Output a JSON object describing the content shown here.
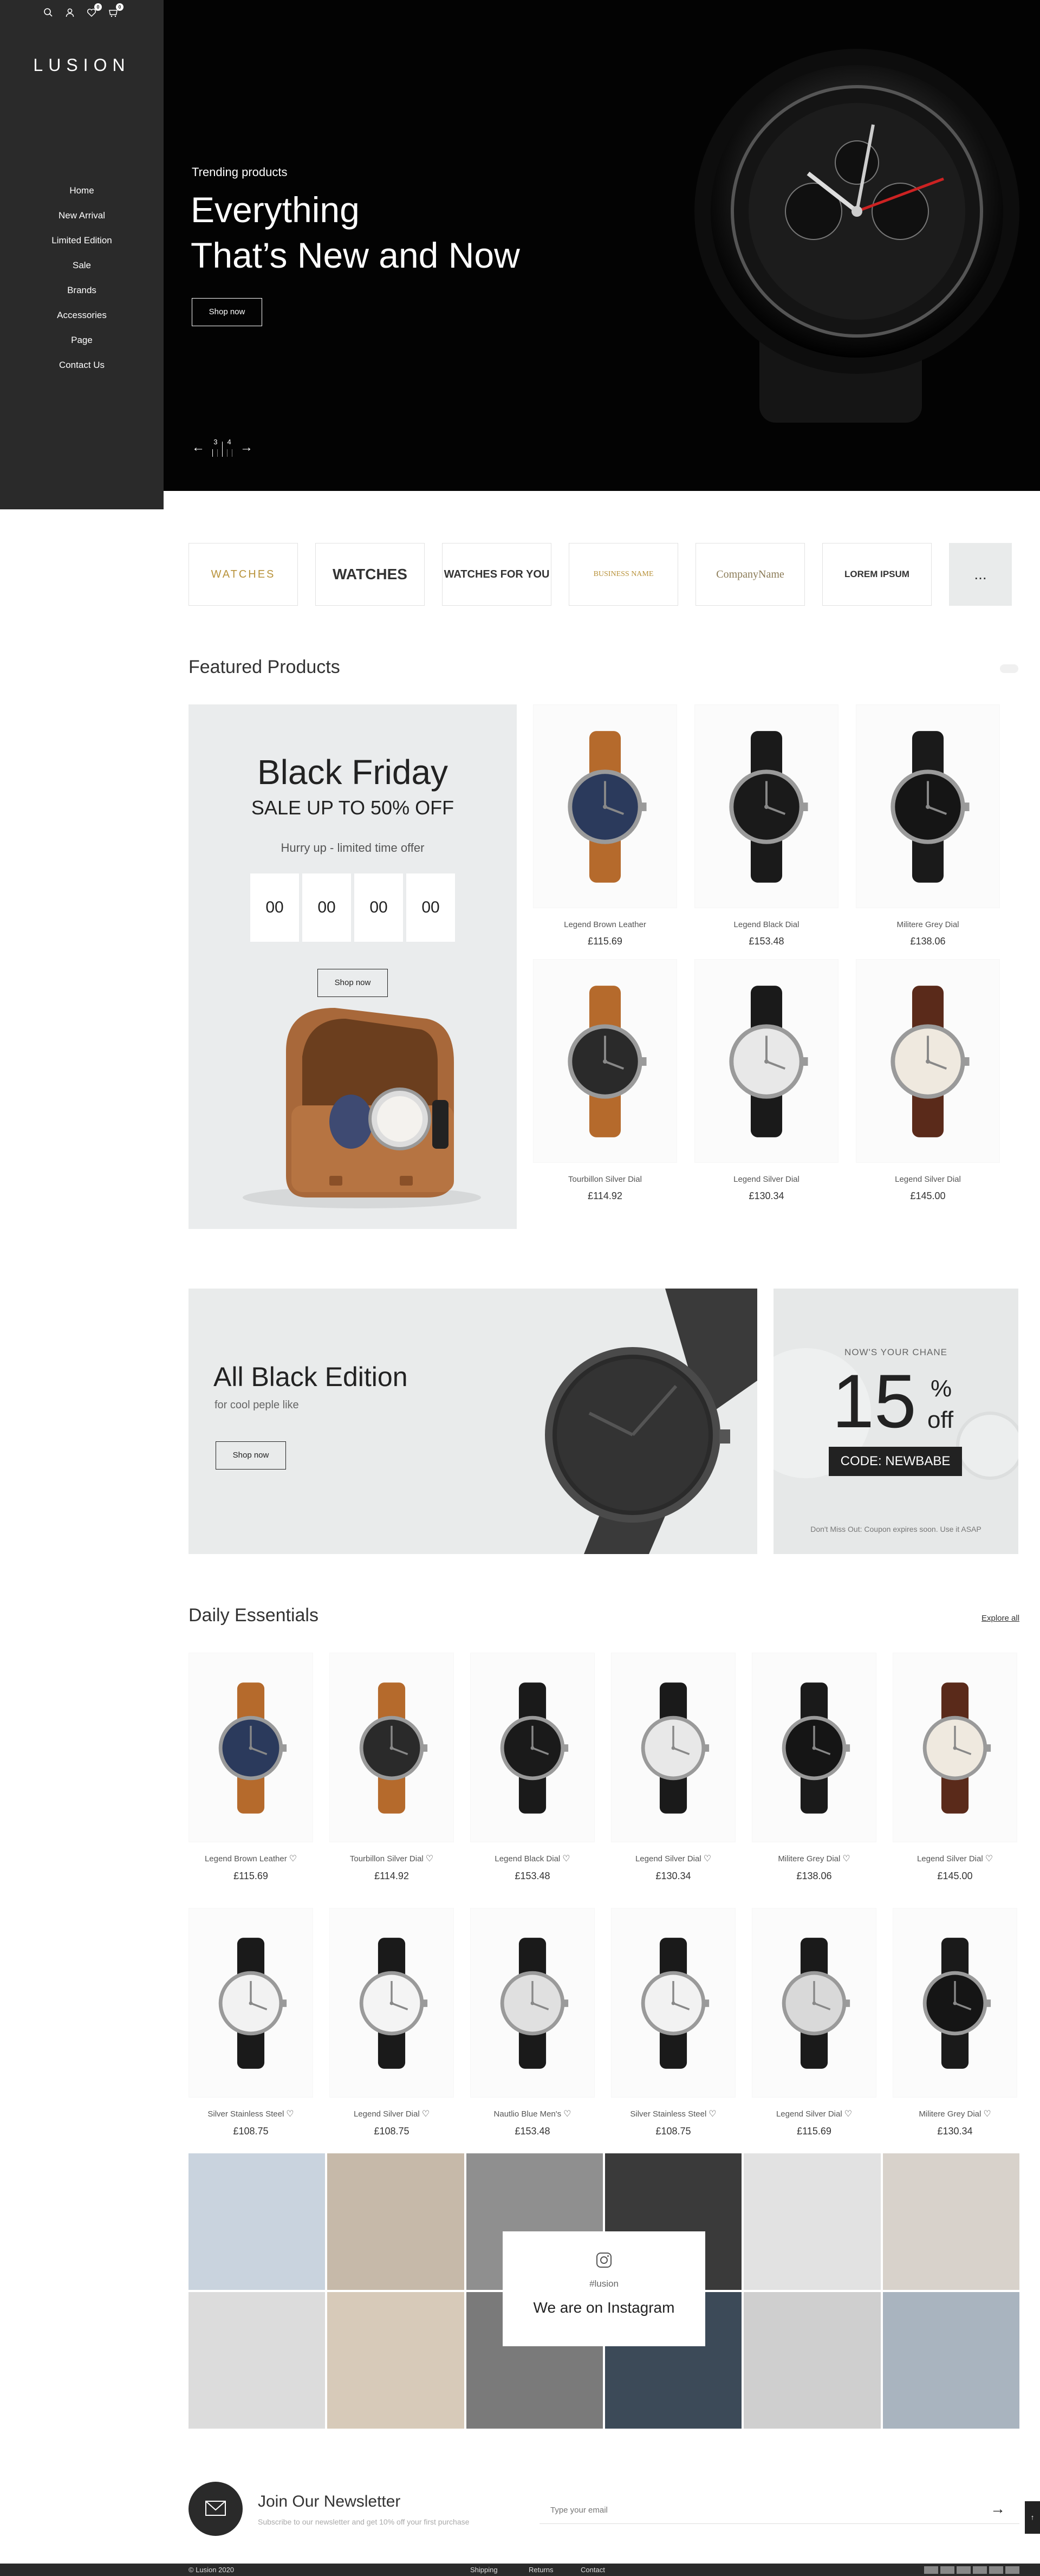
{
  "brand": "LUSION",
  "sidebar": {
    "items": [
      "Home",
      "New Arrival",
      "Limited Edition",
      "Sale",
      "Brands",
      "Accessories",
      "Page",
      "Contact Us"
    ],
    "wishlist_count": "0",
    "cart_count": "0"
  },
  "hero": {
    "subtitle": "Trending products",
    "title_line1": "Everything",
    "title_line2": "That’s New and Now",
    "button": "Shop now",
    "slide_current": "3",
    "slide_next": "4"
  },
  "brands": [
    "WATCHES",
    "WATCHES",
    "WATCHES FOR YOU",
    "BUSINESS NAME",
    "CompanyName",
    "LOREM IPSUM",
    "..."
  ],
  "featured": {
    "title": "Featured Products",
    "promo": {
      "title": "Black Friday",
      "subtitle": "SALE UP TO 50% OFF",
      "hurry": "Hurry up - limited time offer",
      "countdown": [
        "00",
        "00",
        "00",
        "00"
      ],
      "button": "Shop now"
    },
    "products": [
      {
        "name": "Legend Brown Leather",
        "price": "£115.69",
        "face": "#2b3a5c",
        "strap": "#b56a2c"
      },
      {
        "name": "Legend Black Dial",
        "price": "£153.48",
        "face": "#1a1a1a",
        "strap": "#1a1a1a"
      },
      {
        "name": "Militere Grey Dial",
        "price": "£138.06",
        "face": "#151515",
        "strap": "#1a1a1a"
      },
      {
        "name": "Tourbillon Silver Dial",
        "price": "£114.92",
        "face": "#2a2a2a",
        "strap": "#b56a2c"
      },
      {
        "name": "Legend Silver Dial",
        "price": "£130.34",
        "face": "#e8e8e8",
        "strap": "#1a1a1a"
      },
      {
        "name": "Legend Silver Dial",
        "price": "£145.00",
        "face": "#efe9df",
        "strap": "#5a2a1a"
      }
    ]
  },
  "all_black": {
    "title": "All Black Edition",
    "subtitle": "for cool peple like",
    "button": "Shop now"
  },
  "coupon": {
    "kicker": "NOW'S YOUR CHANE",
    "number": "15",
    "percent": "%",
    "off": "off",
    "code": "CODE: NEWBABE",
    "note": "Don't Miss Out: Coupon expires soon. Use it ASAP"
  },
  "daily": {
    "title": "Daily Essentials",
    "explore": "Explore all",
    "products": [
      {
        "name": "Legend Brown Leather",
        "price": "£115.69",
        "face": "#2b3a5c",
        "strap": "#b56a2c"
      },
      {
        "name": "Tourbillon Silver Dial",
        "price": "£114.92",
        "face": "#2a2a2a",
        "strap": "#b56a2c"
      },
      {
        "name": "Legend Black Dial",
        "price": "£153.48",
        "face": "#1a1a1a",
        "strap": "#1a1a1a"
      },
      {
        "name": "Legend Silver Dial",
        "price": "£130.34",
        "face": "#e8e8e8",
        "strap": "#1a1a1a"
      },
      {
        "name": "Militere Grey Dial",
        "price": "£138.06",
        "face": "#151515",
        "strap": "#1a1a1a"
      },
      {
        "name": "Legend Silver Dial",
        "price": "£145.00",
        "face": "#efe9df",
        "strap": "#5a2a1a"
      },
      {
        "name": "Silver Stainless Steel",
        "price": "£108.75",
        "face": "#f2f2f2",
        "strap": "#1a1a1a"
      },
      {
        "name": "Legend Silver Dial",
        "price": "£108.75",
        "face": "#f4f4f4",
        "strap": "#1a1a1a"
      },
      {
        "name": "Nautlio Blue Men's",
        "price": "£153.48",
        "face": "#e0e0e0",
        "strap": "#1a1a1a"
      },
      {
        "name": "Silver Stainless Steel",
        "price": "£108.75",
        "face": "#f2f2f2",
        "strap": "#1a1a1a"
      },
      {
        "name": "Legend Silver Dial",
        "price": "£115.69",
        "face": "#d9d9d9",
        "strap": "#1a1a1a"
      },
      {
        "name": "Militere Grey Dial",
        "price": "£130.34",
        "face": "#151515",
        "strap": "#1a1a1a"
      }
    ]
  },
  "instagram": {
    "handle": "#lusion",
    "title": "We are on Instagram"
  },
  "newsletter": {
    "title": "Join Our Newsletter",
    "subtitle": "Subscribe to our newsletter and get 10% off your first purchase",
    "placeholder": "Type your email"
  },
  "footer": {
    "copyright": "© Lusion 2020",
    "links": [
      "Shipping",
      "Returns",
      "Contact"
    ]
  }
}
